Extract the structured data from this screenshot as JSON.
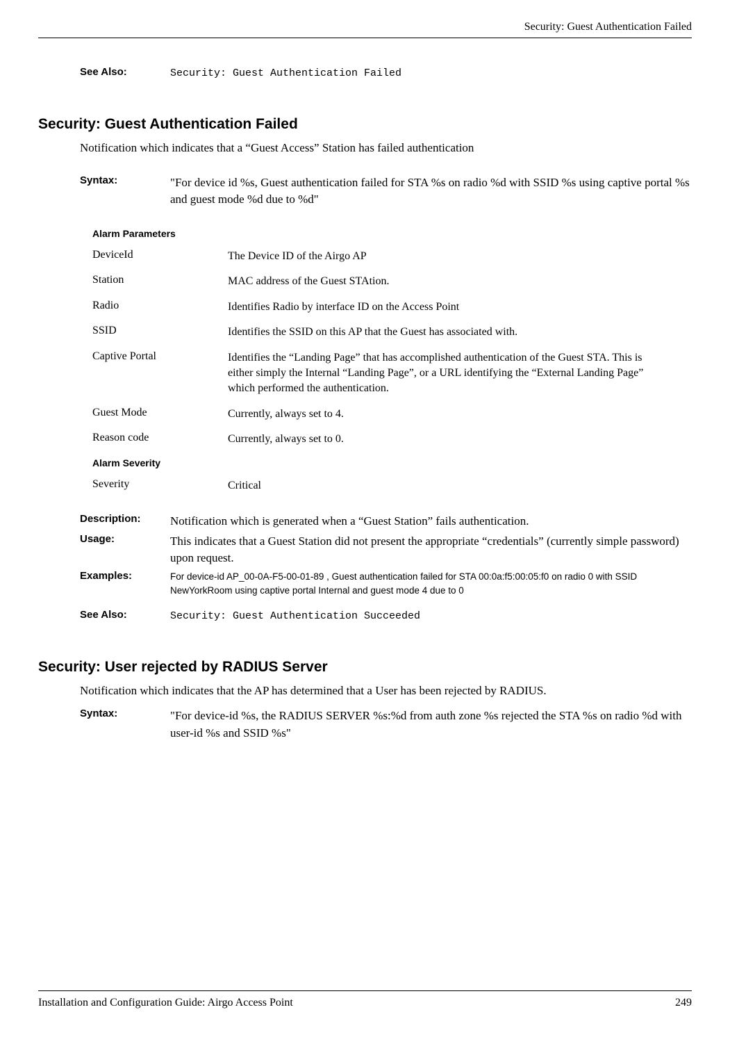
{
  "header": {
    "title": "Security: Guest Authentication Failed"
  },
  "topSeeAlso": {
    "label": "See Also:",
    "value": "Security: Guest Authentication Failed"
  },
  "section1": {
    "title": "Security: Guest Authentication Failed",
    "intro": "Notification which indicates that a “Guest Access” Station has failed authentication",
    "syntax": {
      "label": "Syntax:",
      "value": "\"For device id %s,  Guest authentication failed for STA %s on radio %d with SSID %s using captive portal %s and guest mode %d due to %d\""
    },
    "alarmParamsHeader": "Alarm Parameters",
    "params": [
      {
        "name": "DeviceId",
        "desc": "The Device ID of the Airgo AP"
      },
      {
        "name": "Station",
        "desc": "MAC address of the Guest STAtion."
      },
      {
        "name": "Radio",
        "desc": "Identifies Radio by interface ID on the Access Point"
      },
      {
        "name": "SSID",
        "desc": "Identifies the SSID on this AP that the Guest has associated with."
      },
      {
        "name": "Captive Portal",
        "desc": "Identifies the “Landing Page” that has accomplished authentication of the Guest STA. This is either simply the Internal “Landing Page”, or a URL identifying the “External Landing Page” which performed the authentication."
      },
      {
        "name": "Guest Mode",
        "desc": "Currently, always set to 4."
      },
      {
        "name": "Reason code",
        "desc": "Currently, always set to 0."
      }
    ],
    "alarmSeverityHeader": "Alarm Severity",
    "severity": {
      "name": "Severity",
      "desc": "Critical"
    },
    "description": {
      "label": "Description:",
      "value": "Notification which is generated when a “Guest Station” fails authentication."
    },
    "usage": {
      "label": "Usage:",
      "value": "This indicates that a Guest Station did not present the appropriate “credentials” (currently simple password) upon request."
    },
    "examples": {
      "label": "Examples:",
      "value": "For device-id AP_00-0A-F5-00-01-89 , Guest authentication failed for STA 00:0a:f5:00:05:f0 on radio 0 with SSID NewYorkRoom using captive portal Internal and guest mode 4 due to 0"
    },
    "seeAlso": {
      "label": "See Also:",
      "value": "Security: Guest Authentication Succeeded"
    }
  },
  "section2": {
    "title": "Security: User rejected by RADIUS Server",
    "intro": "Notification which indicates that the AP has determined that a User has been rejected by RADIUS.",
    "syntax": {
      "label": "Syntax:",
      "value": "\"For device-id %s, the RADIUS SERVER %s:%d from auth zone %s rejected the STA %s on radio %d with user-id %s and SSID %s\""
    }
  },
  "footer": {
    "left": "Installation and Configuration Guide: Airgo Access Point",
    "right": "249"
  }
}
